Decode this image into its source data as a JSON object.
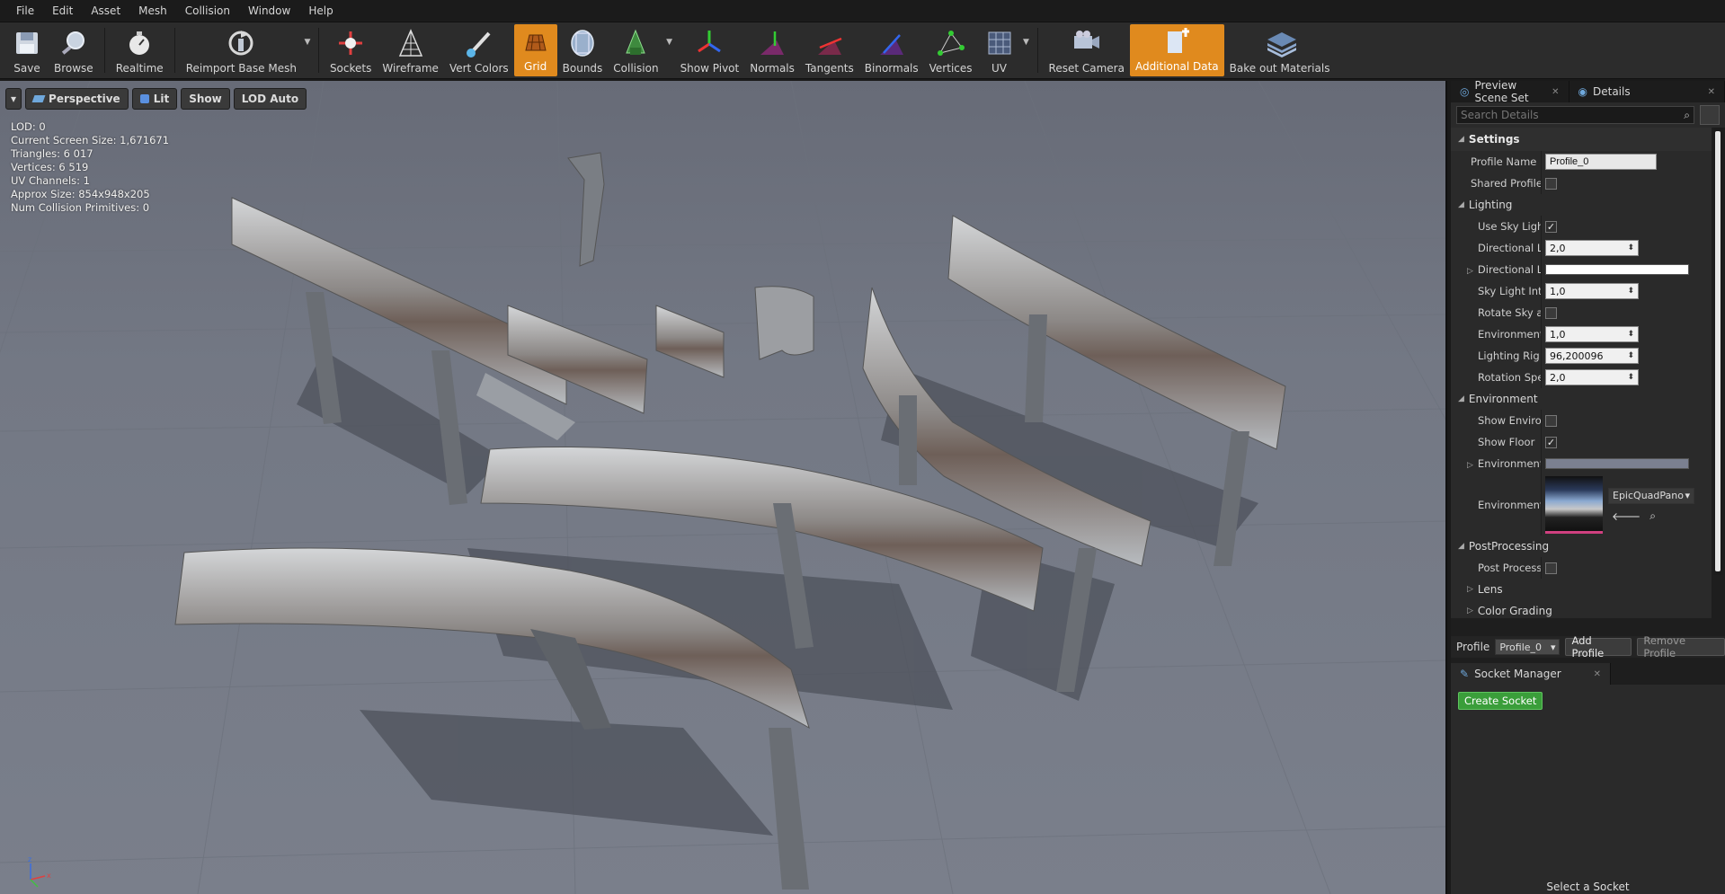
{
  "menu": [
    "File",
    "Edit",
    "Asset",
    "Mesh",
    "Collision",
    "Window",
    "Help"
  ],
  "toolbar": {
    "save": "Save",
    "browse": "Browse",
    "realtime": "Realtime",
    "reimport": "Reimport Base Mesh",
    "sockets": "Sockets",
    "wireframe": "Wireframe",
    "vertcolors": "Vert Colors",
    "grid": "Grid",
    "bounds": "Bounds",
    "collision": "Collision",
    "showpivot": "Show Pivot",
    "normals": "Normals",
    "tangents": "Tangents",
    "binormals": "Binormals",
    "vertices": "Vertices",
    "uv": "UV",
    "resetcamera": "Reset Camera",
    "additionaldata": "Additional Data",
    "bakeout": "Bake out Materials"
  },
  "viewport": {
    "perspective": "Perspective",
    "lit": "Lit",
    "show": "Show",
    "lod": "LOD Auto",
    "stats": [
      "LOD:  0",
      "Current Screen Size:  1,671671",
      "Triangles:  6 017",
      "Vertices:  6 519",
      "UV Channels:  1",
      "Approx Size: 854x948x205",
      "Num Collision Primitives:  0"
    ]
  },
  "panel": {
    "tab_preview": "Preview Scene Set",
    "tab_details": "Details",
    "search_placeholder": "Search Details",
    "settings": "Settings",
    "profile_name_label": "Profile Name",
    "profile_name_value": "Profile_0",
    "shared_profile": "Shared Profile",
    "lighting": "Lighting",
    "use_sky": "Use Sky Lighti",
    "dir_light": "Directional Lig",
    "dir_light_val": "2,0",
    "dir_light_color": "Directional Lic",
    "sky_intensity": "Sky Light Inter",
    "sky_intensity_val": "1,0",
    "rotate_sky": "Rotate Sky anc",
    "env_intensity": "Environment Ir",
    "env_intensity_val": "1,0",
    "rig_rotation": "Lighting Rig Ro",
    "rig_rotation_val": "96,200096",
    "rotation_speed": "Rotation Spee",
    "rotation_speed_val": "2,0",
    "environment": "Environment",
    "show_env": "Show Environn",
    "show_floor": "Show Floor",
    "env_color": "Environment C",
    "env_cube": "Environment C",
    "cubemap_name": "EpicQuadPanora",
    "postprocessing": "PostProcessing",
    "post_enabled": "Post Processin",
    "lens": "Lens",
    "color_grading": "Color Grading",
    "profile_label": "Profile",
    "profile_select": "Profile_0",
    "add_profile": "Add Profile",
    "remove_profile": "Remove Profile",
    "socket_manager": "Socket Manager",
    "create_socket": "Create Socket",
    "select_socket": "Select a Socket"
  },
  "colors": {
    "accent": "#e08a1e",
    "green": "#3a9e3a"
  }
}
